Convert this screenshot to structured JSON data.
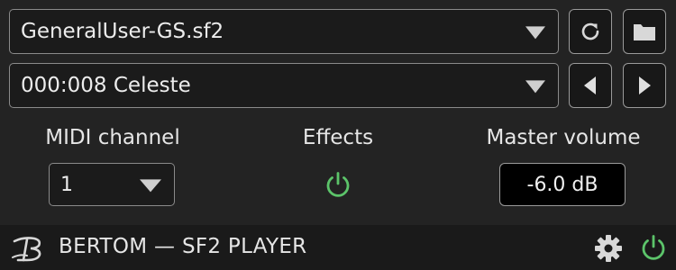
{
  "soundfont": {
    "selected": "GeneralUser-GS.sf2"
  },
  "preset": {
    "selected": "000:008 Celeste"
  },
  "toolbar": {
    "reload_icon": "refresh-icon",
    "folder_icon": "folder-icon",
    "prev_icon": "triangle-left-icon",
    "next_icon": "triangle-right-icon"
  },
  "midi": {
    "label": "MIDI channel",
    "selected": "1"
  },
  "effects": {
    "label": "Effects",
    "enabled": true
  },
  "master": {
    "label": "Master volume",
    "value": "-6.0 dB"
  },
  "footer": {
    "brand": "BERTOM — SF2 PLAYER",
    "settings_icon": "gear-icon",
    "power_icon": "power-icon"
  },
  "colors": {
    "accent_green": "#5cc46a",
    "background": "#232323",
    "footer": "#1a1a1a"
  }
}
